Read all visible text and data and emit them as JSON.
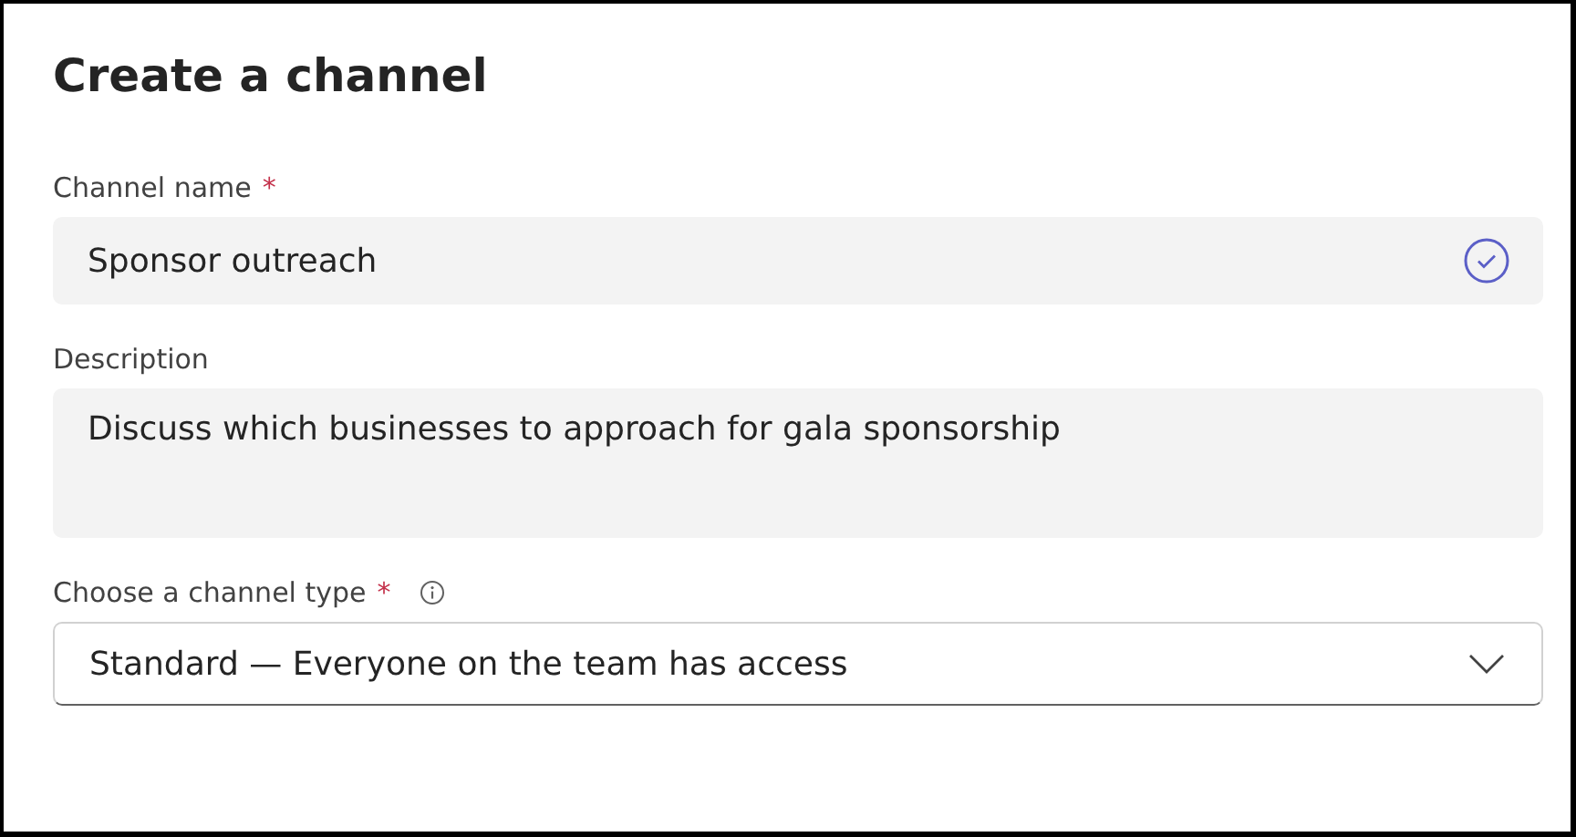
{
  "dialog": {
    "title": "Create a channel"
  },
  "fields": [
    {
      "kind": "text",
      "label": "Channel name",
      "required_mark": "*",
      "info": false,
      "value": "Sponsor outreach",
      "valid": true
    },
    {
      "kind": "textarea",
      "label": "Description",
      "info": false,
      "value": "Discuss which businesses to approach for gala sponsorship",
      "valid": false
    },
    {
      "kind": "dropdown",
      "label": "Choose a channel type",
      "required_mark": "*",
      "info": true,
      "value": "Standard — Everyone on the team has access",
      "valid": false
    }
  ]
}
